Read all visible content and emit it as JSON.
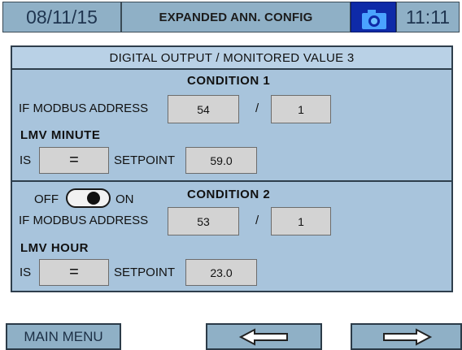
{
  "header": {
    "date": "08/11/15",
    "title": "EXPANDED ANN. CONFIG",
    "camera_icon": "camera-icon",
    "time": "11:11"
  },
  "panel": {
    "subtitle": "DIGITAL OUTPUT / MONITORED VALUE 3"
  },
  "condition1": {
    "title": "CONDITION 1",
    "modbus_label": "IF MODBUS ADDRESS",
    "address": "54",
    "separator": "/",
    "sub_address": "1",
    "variable": "LMV MINUTE",
    "is_label": "IS",
    "operator": "=",
    "setpoint_label": "SETPOINT",
    "setpoint": "59.0"
  },
  "condition2": {
    "toggle_off_label": "OFF",
    "toggle_on_label": "ON",
    "toggle_state": "on",
    "title": "CONDITION 2",
    "modbus_label": "IF MODBUS ADDRESS",
    "address": "53",
    "separator": "/",
    "sub_address": "1",
    "variable": "LMV HOUR",
    "is_label": "IS",
    "operator": "=",
    "setpoint_label": "SETPOINT",
    "setpoint": "23.0"
  },
  "footer": {
    "main_menu_label": "MAIN MENU",
    "back_icon": "arrow-left-icon",
    "forward_icon": "arrow-right-icon"
  },
  "colors": {
    "header_bg": "#8fb0c6",
    "panel_bg": "#a8c4dc",
    "field_bg": "#d3d3d3",
    "camera_bg": "#0e2aa8"
  }
}
